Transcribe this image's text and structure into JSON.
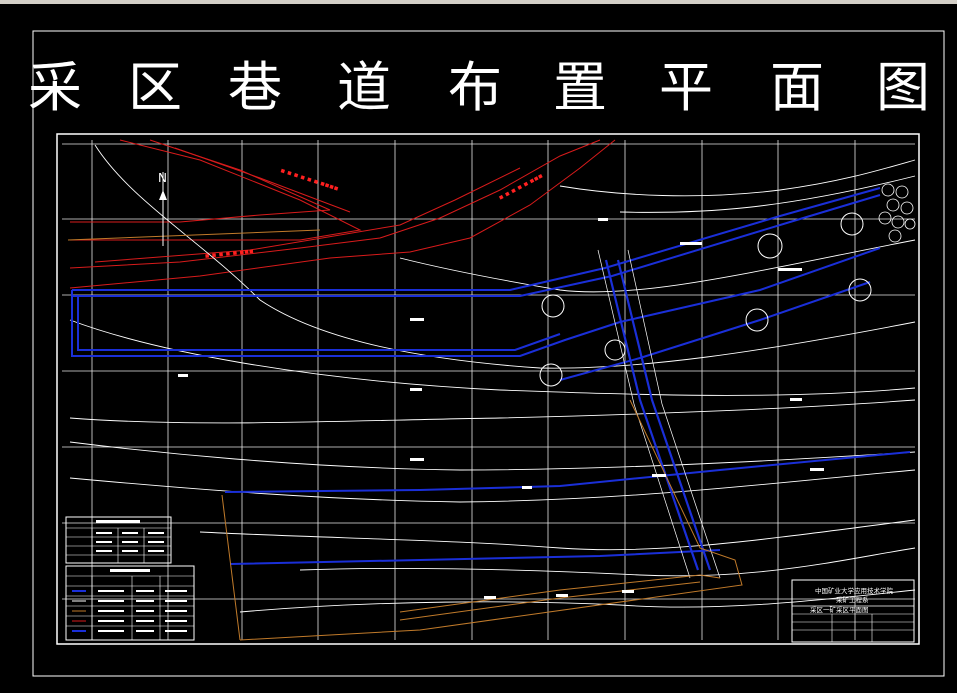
{
  "drawing": {
    "title_chars": [
      "采",
      "区",
      "巷",
      "道",
      "布",
      "置",
      "平",
      "面",
      "图"
    ],
    "north_label": "N",
    "title_block": {
      "line1": "中国矿业大学应用技术学院",
      "line2": "采矿工程系",
      "drawing_name": "采区一矿采区平面图"
    }
  }
}
